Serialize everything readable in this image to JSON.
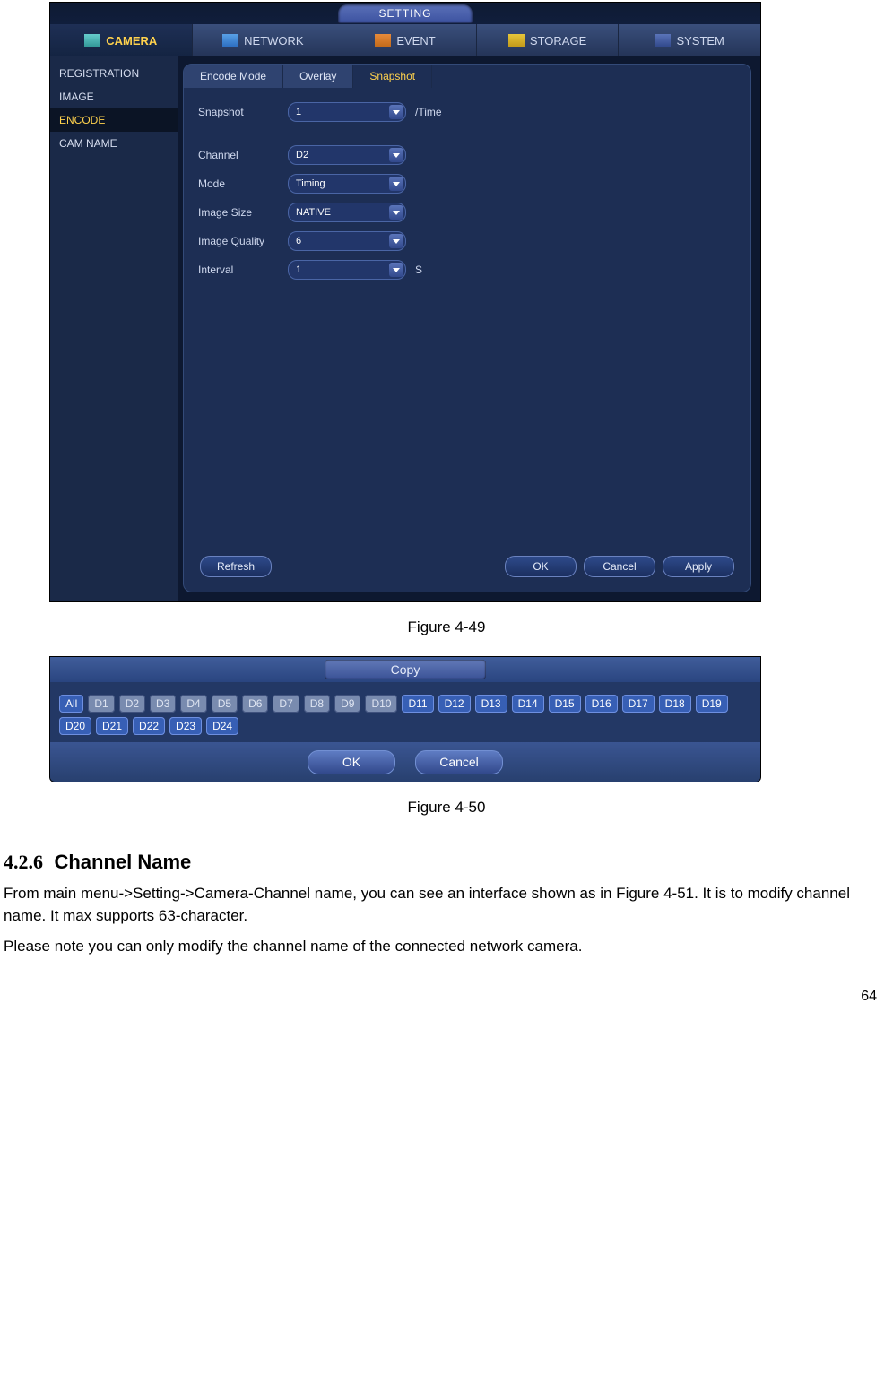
{
  "settingWindow": {
    "title": "SETTING",
    "nav": [
      {
        "label": "CAMERA",
        "active": true
      },
      {
        "label": "NETWORK",
        "active": false
      },
      {
        "label": "EVENT",
        "active": false
      },
      {
        "label": "STORAGE",
        "active": false
      },
      {
        "label": "SYSTEM",
        "active": false
      }
    ],
    "side": [
      {
        "label": "REGISTRATION",
        "active": false
      },
      {
        "label": "IMAGE",
        "active": false
      },
      {
        "label": "ENCODE",
        "active": true
      },
      {
        "label": "CAM NAME",
        "active": false
      }
    ],
    "tabs": [
      {
        "label": "Encode Mode",
        "active": false
      },
      {
        "label": "Overlay",
        "active": false
      },
      {
        "label": "Snapshot",
        "active": true
      }
    ],
    "form": {
      "snapshot_label": "Snapshot",
      "snapshot_value": "1",
      "snapshot_unit": "/Time",
      "channel_label": "Channel",
      "channel_value": "D2",
      "mode_label": "Mode",
      "mode_value": "Timing",
      "size_label": "Image Size",
      "size_value": "NATIVE",
      "quality_label": "Image Quality",
      "quality_value": "6",
      "interval_label": "Interval",
      "interval_value": "1",
      "interval_unit": "S"
    },
    "buttons": {
      "refresh": "Refresh",
      "ok": "OK",
      "cancel": "Cancel",
      "apply": "Apply"
    }
  },
  "caption1": "Figure 4-49",
  "copyDialog": {
    "title": "Copy",
    "chips": [
      "All",
      "D1",
      "D2",
      "D3",
      "D4",
      "D5",
      "D6",
      "D7",
      "D8",
      "D9",
      "D10",
      "D11",
      "D12",
      "D13",
      "D14",
      "D15",
      "D16",
      "D17",
      "D18",
      "D19",
      "D20",
      "D21",
      "D22",
      "D23",
      "D24"
    ],
    "selected": [
      "All",
      "D11",
      "D12",
      "D13",
      "D14",
      "D15",
      "D16",
      "D17",
      "D18",
      "D19",
      "D20",
      "D21",
      "D22",
      "D23",
      "D24"
    ],
    "ok": "OK",
    "cancel": "Cancel"
  },
  "caption2": "Figure 4-50",
  "section": {
    "num": "4.2.6",
    "title": "Channel Name",
    "p1": "From main menu->Setting->Camera-Channel name, you can see an interface shown as in Figure 4-51. It is to modify channel name. It max supports 63-character.",
    "p2": "Please note you can only modify the channel name of the connected network camera."
  },
  "pageNumber": "64"
}
